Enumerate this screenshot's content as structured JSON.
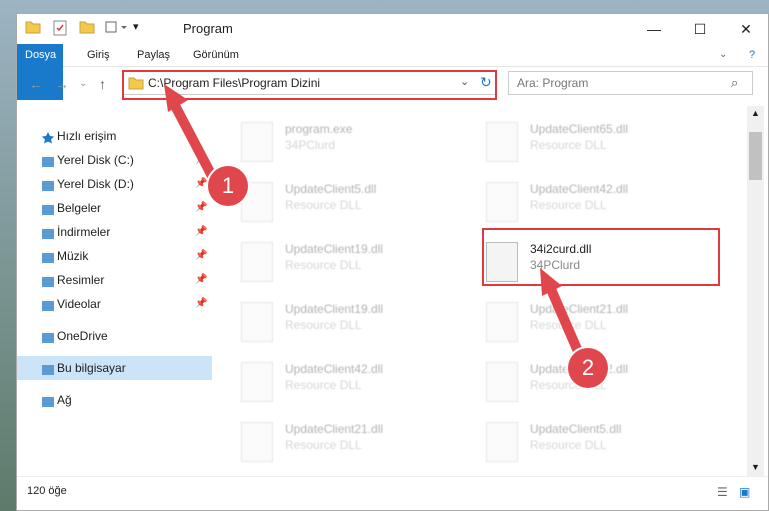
{
  "window": {
    "title": "Program"
  },
  "ribbon": {
    "tabs": [
      "Dosya",
      "Giriş",
      "Paylaş",
      "Görünüm"
    ]
  },
  "address": {
    "path": "C:\\Program Files\\Program Dizini"
  },
  "search": {
    "placeholder": "Ara: Program"
  },
  "sidebar": {
    "items": [
      {
        "label": "Hızlı erişim",
        "icon": "star-icon",
        "pinned": false
      },
      {
        "label": "Yerel Disk (C:)",
        "icon": "drive-icon",
        "pinned": true
      },
      {
        "label": "Yerel Disk (D:)",
        "icon": "drive-icon",
        "pinned": true
      },
      {
        "label": "Belgeler",
        "icon": "document-icon",
        "pinned": true
      },
      {
        "label": "İndirmeler",
        "icon": "download-icon",
        "pinned": true
      },
      {
        "label": "Müzik",
        "icon": "music-icon",
        "pinned": true
      },
      {
        "label": "Resimler",
        "icon": "picture-icon",
        "pinned": true
      },
      {
        "label": "Videolar",
        "icon": "video-icon",
        "pinned": true
      },
      {
        "label": "OneDrive",
        "icon": "cloud-icon",
        "pinned": false
      },
      {
        "label": "Bu bilgisayar",
        "icon": "computer-icon",
        "pinned": false
      },
      {
        "label": "Ağ",
        "icon": "network-icon",
        "pinned": false
      }
    ]
  },
  "files": [
    {
      "name": "program.exe",
      "type": "34PClurd"
    },
    {
      "name": "UpdateClient65.dll",
      "type": "Resource DLL"
    },
    {
      "name": "UpdateClient5.dll",
      "type": "Resource DLL"
    },
    {
      "name": "UpdateClient42.dll",
      "type": "Resource DLL"
    },
    {
      "name": "UpdateClient19.dll",
      "type": "Resource DLL"
    },
    {
      "name": "34i2curd.dll",
      "type": "34PClurd"
    },
    {
      "name": "UpdateClient19.dll",
      "type": "Resource DLL"
    },
    {
      "name": "UpdateClient21.dll",
      "type": "Resource DLL"
    },
    {
      "name": "UpdateClient42.dll",
      "type": "Resource DLL"
    },
    {
      "name": "UpdateClient42.dll",
      "type": "Resource DLL"
    },
    {
      "name": "UpdateClient21.dll",
      "type": "Resource DLL"
    },
    {
      "name": "UpdateClient5.dll",
      "type": "Resource DLL"
    }
  ],
  "status": {
    "count": "120 öğe"
  },
  "annotations": {
    "step1": "1",
    "step2": "2"
  },
  "colors": {
    "accent": "#1979ca",
    "highlight": "#e03a3e"
  }
}
